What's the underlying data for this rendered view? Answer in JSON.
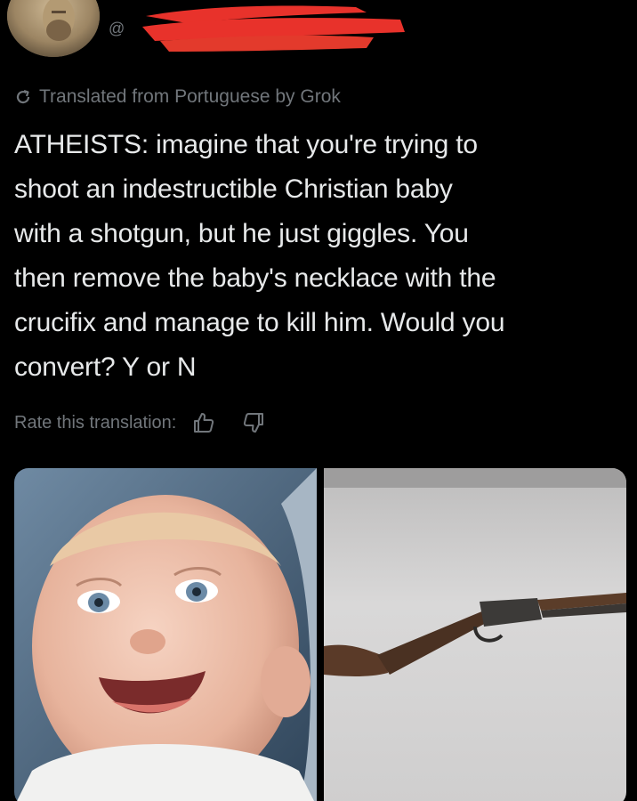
{
  "header": {
    "handle": "@",
    "avatar_icon": "user-avatar",
    "redaction_color": "#e8322b"
  },
  "translation": {
    "icon": "refresh-icon",
    "label": "Translated from Portuguese by Grok"
  },
  "post": {
    "text": "ATHEISTS: imagine that you're trying to\nshoot an indestructible Christian baby\nwith a shotgun, but he just giggles. You\nthen remove the baby's necklace with the\ncrucifix and manage to kill him. Would you\nconvert? Y or N"
  },
  "rating": {
    "label": "Rate this translation:",
    "up_icon": "thumbs-up-icon",
    "down_icon": "thumbs-down-icon"
  },
  "media": [
    {
      "kind": "photo",
      "subject": "baby-photo"
    },
    {
      "kind": "photo",
      "subject": "shotgun-photo"
    }
  ],
  "colors": {
    "background": "#000000",
    "text": "#e7e9ea",
    "muted": "#71767b"
  }
}
